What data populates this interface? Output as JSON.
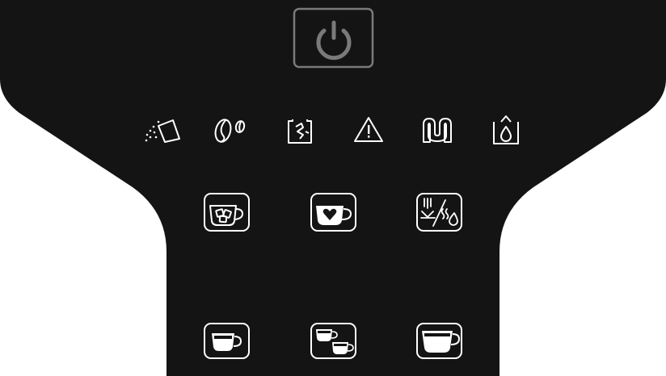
{
  "panel": {
    "background_color": "#141414",
    "icon_color": "#ffffff",
    "power_color": "#7a7a7a"
  },
  "power": {
    "icon": "power-icon",
    "state": "off"
  },
  "indicators": [
    {
      "icon": "descale-powder-icon"
    },
    {
      "icon": "coffee-beans-icon"
    },
    {
      "icon": "grounds-container-icon"
    },
    {
      "icon": "warning-icon"
    },
    {
      "icon": "water-circuit-icon"
    },
    {
      "icon": "water-tank-icon"
    }
  ],
  "specialty_buttons": [
    {
      "icon": "iced-coffee-cup-icon"
    },
    {
      "icon": "my-coffee-heart-cup-icon"
    },
    {
      "icon": "hot-water-steam-icon"
    }
  ],
  "brew_buttons": [
    {
      "icon": "small-cup-icon"
    },
    {
      "icon": "two-cups-icon"
    },
    {
      "icon": "large-cup-icon"
    }
  ]
}
